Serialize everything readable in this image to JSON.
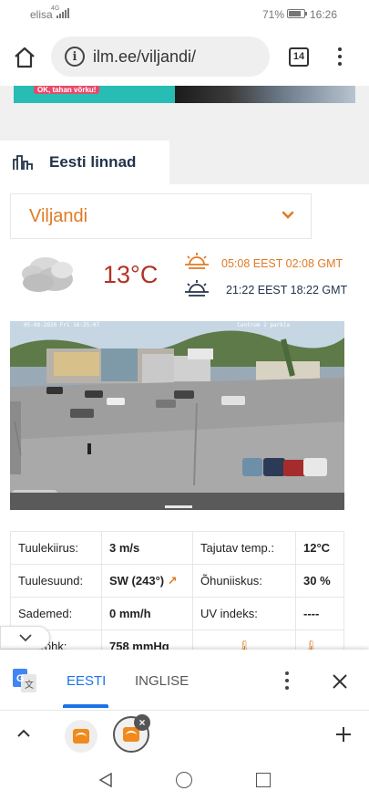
{
  "status_bar": {
    "carrier": "elisa",
    "network": "4G",
    "battery_percent": "71%",
    "time": "16:26"
  },
  "browser": {
    "url": "ilm.ee/viljandi/",
    "tab_count": "14"
  },
  "banner": {
    "text": "OK, tahan võrku!"
  },
  "section": {
    "title": "Eesti linnad"
  },
  "city_select": {
    "selected": "Viljandi"
  },
  "weather": {
    "temperature": "13°C",
    "sunrise": "05:08 EEST 02:08 GMT",
    "sunset": "21:22 EEST 18:22 GMT"
  },
  "webcam": {
    "timestamp": "05-08-2020 Fri 16:25:07",
    "location": "Centrum 2 parkla"
  },
  "observations": [
    {
      "label": "Tuulekiirus:",
      "value": "3 m/s",
      "label2": "Tajutav temp.:",
      "value2": "12°C"
    },
    {
      "label": "Tuulesuund:",
      "value": "SW (243°)",
      "label2": "Õhuniiskus:",
      "value2": "30 %"
    },
    {
      "label": "Sademed:",
      "value": "0 mm/h",
      "label2": "UV indeks:",
      "value2": "----"
    },
    {
      "label": "Õhurõhk:",
      "value": "758 mmHg",
      "label2": "",
      "value2": ""
    }
  ],
  "translate_bar": {
    "lang_active": "EESTI",
    "lang_other": "INGLISE"
  },
  "colors": {
    "accent_orange": "#e07a24",
    "temp_red": "#b03324",
    "translate_blue": "#1a73e8"
  }
}
